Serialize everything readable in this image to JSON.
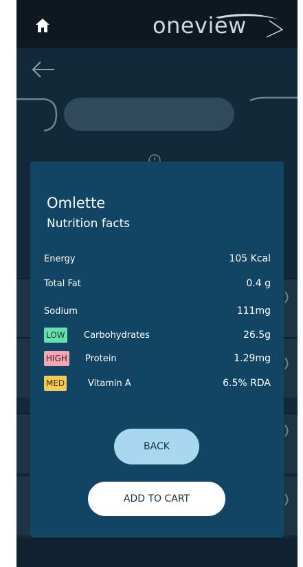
{
  "header": {
    "logo_text": "oneview",
    "home_icon": "home-icon"
  },
  "nav": {
    "back_icon": "arrow-left-icon"
  },
  "modal": {
    "title": "Omlette",
    "subtitle": "Nutrition facts",
    "rows": [
      {
        "label": "Energy",
        "value": "105 Kcal",
        "badge": ""
      },
      {
        "label": "Total Fat",
        "value": "0.4 g",
        "badge": ""
      },
      {
        "label": "Sodium",
        "value": "111mg",
        "badge": ""
      },
      {
        "label": "Carbohydrates",
        "value": "26.5g",
        "badge": "LOW"
      },
      {
        "label": "Protein",
        "value": "1.29mg",
        "badge": "HIGH"
      },
      {
        "label": "Vitamin A",
        "value": "6.5% RDA",
        "badge": "MED"
      }
    ],
    "back_label": "BACK",
    "cart_label": "ADD TO CART"
  },
  "colors": {
    "background": "#12293a",
    "modal": "#124463",
    "low": "#67dfb1",
    "high": "#f3a7b4",
    "med": "#f5c85a",
    "back_button": "#a8d8ee"
  }
}
